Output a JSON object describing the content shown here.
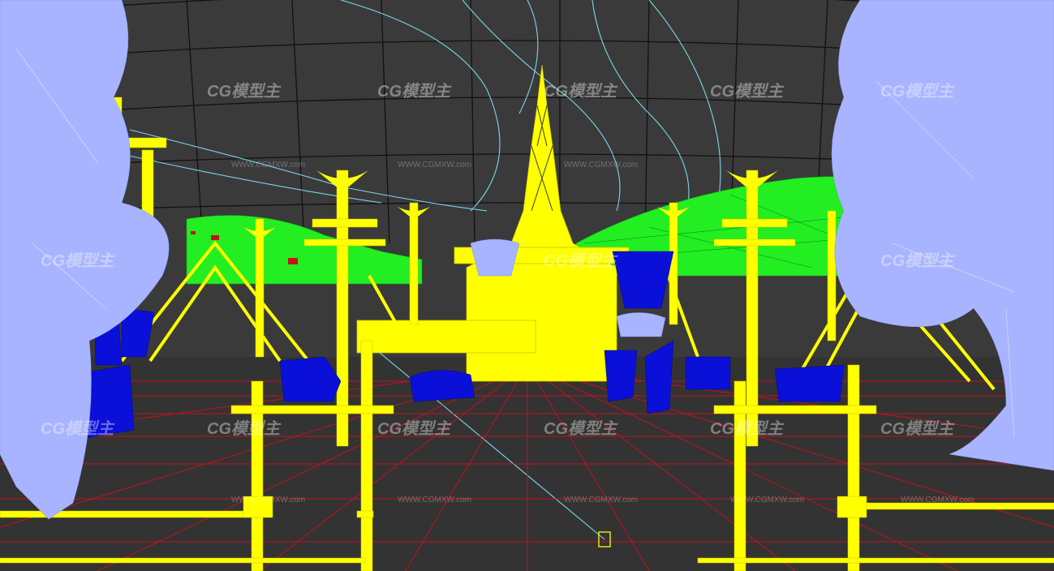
{
  "viewport": {
    "render_mode": "wireframe",
    "colors": {
      "background": "#3a3a3a",
      "sky_grid": "#141414",
      "ground_grid": "#d0141e",
      "ground": "#343434",
      "structures": "#ffff00",
      "trees": "#aab4ff",
      "props": "#0a10d8",
      "hills": "#2aff2a",
      "spline": "#7ad6e8"
    }
  },
  "watermarks": {
    "logo_text": "CG模型主",
    "url_text": "WWW.CGMXW.com"
  }
}
